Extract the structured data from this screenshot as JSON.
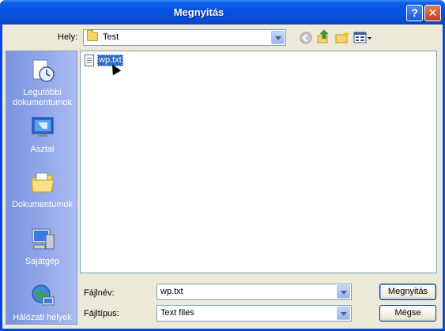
{
  "window": {
    "title": "Megnyitás"
  },
  "lookin": {
    "label": "Hely:",
    "value": "Test"
  },
  "places": [
    {
      "label": "Legutóbbi dokumentumok",
      "icon": "recent-docs-icon"
    },
    {
      "label": "Asztal",
      "icon": "desktop-icon"
    },
    {
      "label": "Dokumentumok",
      "icon": "my-documents-icon"
    },
    {
      "label": "Sajátgép",
      "icon": "my-computer-icon"
    },
    {
      "label": "Hálózati helyek",
      "icon": "network-places-icon"
    }
  ],
  "files": [
    {
      "name": "wp.txt",
      "selected": true
    }
  ],
  "filename": {
    "label": "Fájlnév:",
    "value": "wp.txt"
  },
  "filetype": {
    "label": "Fájltípus:",
    "value": "Text files"
  },
  "buttons": {
    "open": "Megnyitás",
    "cancel": "Mégse"
  },
  "colors": {
    "title_bar": "#0553e0",
    "places_bar": "#7a92e0",
    "selection": "#316ac5",
    "dialog_bg": "#ece9d8"
  }
}
